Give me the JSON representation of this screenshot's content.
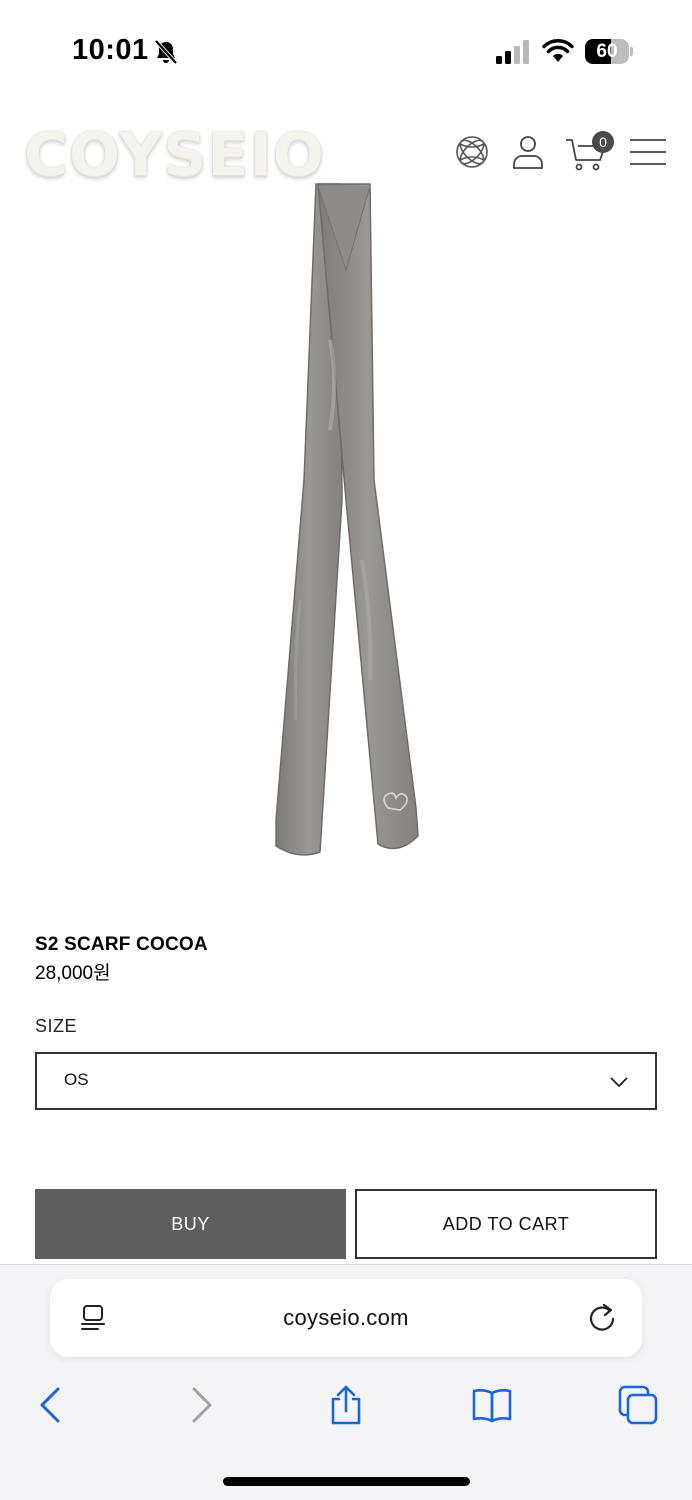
{
  "status_bar": {
    "time": "10:01",
    "battery": "60",
    "battery_level": 0.6,
    "icons": [
      "bell-slash-icon",
      "signal-icon",
      "wifi-icon",
      "battery-icon"
    ]
  },
  "header": {
    "logo": "COYSEIO",
    "cart_count": "0",
    "icons": [
      "globe-icon",
      "user-icon",
      "cart-icon",
      "menu-icon"
    ]
  },
  "product": {
    "name": "S2 SCARF COCOA",
    "price": "28,000원",
    "image": "grey-scarf-image"
  },
  "options": {
    "size_label": "SIZE",
    "size_selected": "OS"
  },
  "actions": {
    "buy_label": "BUY",
    "add_to_cart_label": "ADD TO CART"
  },
  "browser": {
    "url": "coyseio.com",
    "icons": [
      "reader-icon",
      "reload-icon",
      "back-icon",
      "forward-icon",
      "share-icon",
      "bookmarks-icon",
      "tabs-icon"
    ]
  },
  "colors": {
    "buy_button": "#5e5e5e",
    "accent_blue": "#1a66d9",
    "scarf": "#8c8987"
  }
}
